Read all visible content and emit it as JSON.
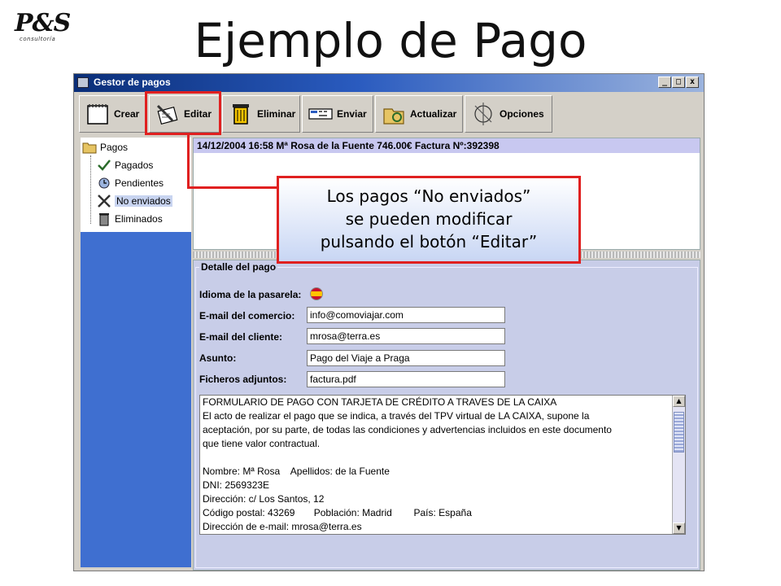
{
  "logo": {
    "text": "P&S",
    "tagline": "consultoría"
  },
  "page_title": "Ejemplo de Pago",
  "window": {
    "title": "Gestor de pagos",
    "controls": [
      "_",
      "□",
      "x"
    ]
  },
  "toolbar": {
    "buttons": [
      {
        "label": "Crear",
        "icon": "notepad-icon"
      },
      {
        "label": "Editar",
        "icon": "edit-pen-icon"
      },
      {
        "label": "Eliminar",
        "icon": "trash-icon"
      },
      {
        "label": "Enviar",
        "icon": "send-icon"
      },
      {
        "label": "Actualizar",
        "icon": "refresh-folder-icon"
      },
      {
        "label": "Opciones",
        "icon": "options-icon"
      }
    ]
  },
  "tree": {
    "root": "Pagos",
    "items": [
      "Pagados",
      "Pendientes",
      "No enviados",
      "Eliminados"
    ],
    "selected": "No enviados"
  },
  "list": {
    "rows": [
      "14/12/2004 16:58 Mª Rosa de la Fuente 746.00€ Factura Nº:392398"
    ]
  },
  "detail": {
    "legend": "Detalle del pago",
    "fields": [
      {
        "label": "Idioma de la pasarela:",
        "value": ""
      },
      {
        "label": "E-mail del comercio:",
        "value": "info@comoviajar.com"
      },
      {
        "label": "E-mail del cliente:",
        "value": "mrosa@terra.es"
      },
      {
        "label": "Asunto:",
        "value": "Pago del Viaje a Praga"
      },
      {
        "label": "Ficheros adjuntos:",
        "value": "factura.pdf"
      }
    ],
    "body_lines": [
      "FORMULARIO DE PAGO CON TARJETA DE CRÉDITO A TRAVES DE LA CAIXA",
      "El acto de realizar el pago que se indica, a través del TPV virtual de LA CAIXA, supone la",
      "aceptación, por su parte, de todas las condiciones y advertencias incluidos en este documento",
      "que tiene valor contractual.",
      "",
      "Nombre: Mª Rosa    Apellidos: de la Fuente",
      "DNI: 2569323E",
      "Dirección: c/ Los Santos, 12",
      "Código postal: 43269       Población: Madrid        País: España",
      "Dirección de e-mail: mrosa@terra.es"
    ]
  },
  "callout": {
    "lines": [
      "Los pagos “No enviados”",
      "se pueden modificar",
      "pulsando el botón “Editar”"
    ]
  },
  "colors": {
    "accent": "#e02020",
    "sidebar": "#3f6fd0",
    "titlebar": "#0a2e78"
  }
}
